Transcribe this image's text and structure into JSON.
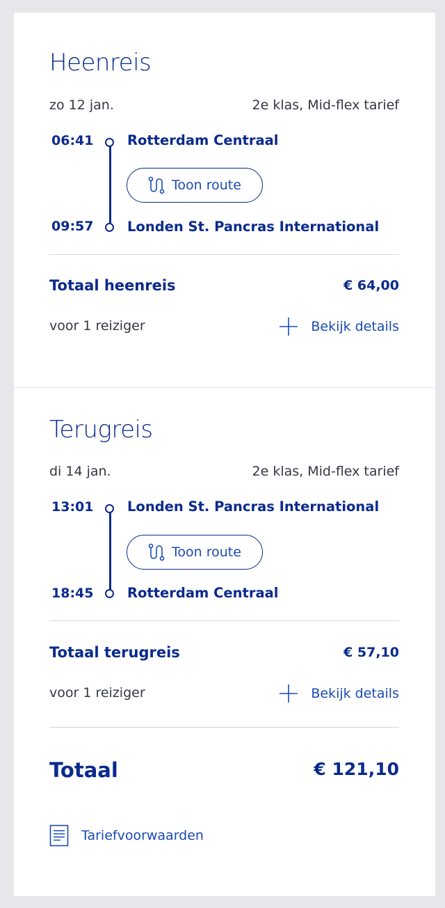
{
  "outbound": {
    "title": "Heenreis",
    "date": "zo 12 jan.",
    "class_fare": "2e klas, Mid-flex tarief",
    "departure": {
      "time": "06:41",
      "station": "Rotterdam Centraal"
    },
    "arrival": {
      "time": "09:57",
      "station": "Londen St. Pancras International"
    },
    "route_button": "Toon route",
    "total_label": "Totaal heenreis",
    "total_price": "€ 64,00",
    "travelers": "voor 1 reiziger",
    "details_link": "Bekijk details"
  },
  "return": {
    "title": "Terugreis",
    "date": "di 14 jan.",
    "class_fare": "2e klas, Mid-flex tarief",
    "departure": {
      "time": "13:01",
      "station": "Londen St. Pancras International"
    },
    "arrival": {
      "time": "18:45",
      "station": "Rotterdam Centraal"
    },
    "route_button": "Toon route",
    "total_label": "Totaal terugreis",
    "total_price": "€ 57,10",
    "travelers": "voor 1 reiziger",
    "details_link": "Bekijk details"
  },
  "summary": {
    "total_label": "Totaal",
    "total_price": "€ 121,10",
    "conditions_link": "Tariefvoorwaarden"
  },
  "icons": {
    "route": "route-icon",
    "plus": "plus-icon",
    "document": "document-icon"
  },
  "colors": {
    "primary": "#0a2a8c",
    "link": "#1a4ab3",
    "text": "#333743",
    "background": "#e7e7eb"
  }
}
